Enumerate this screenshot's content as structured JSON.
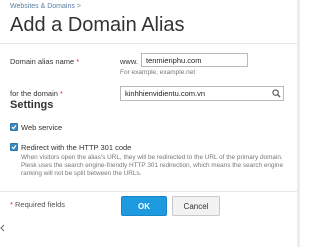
{
  "breadcrumb": {
    "link": "Websites & Domains",
    "separator": ">"
  },
  "page_title": "Add a Domain Alias",
  "form": {
    "alias_name": {
      "label": "Domain alias name",
      "required_mark": "*",
      "prefix": "www.",
      "value": "tenmienphu.com",
      "help": "For example, example.net"
    },
    "for_domain": {
      "label": "for the domain",
      "required_mark": "*",
      "value": "kinhhienvidientu.com.vn",
      "search_icon": "magnifier-icon"
    }
  },
  "settings": {
    "title": "Settings",
    "web_service": {
      "label": "Web service",
      "checked": true
    },
    "redirect_301": {
      "label": "Redirect with the HTTP 301 code",
      "checked": true,
      "description": "When visitors open the alias's URL, they will be redirected to the URL of the primary domain. Plesk uses the search engine-friendly HTTP 301 redirection, which means the search engine ranking will not be split between the URLs."
    }
  },
  "footer": {
    "required_mark": "*",
    "required_note": "Required fields",
    "ok_label": "OK",
    "cancel_label": "Cancel"
  },
  "colors": {
    "primary_button": "#1e9ae0",
    "checkbox": "#3a88c4",
    "required": "#d0312d",
    "link": "#5a7fa6"
  },
  "icons": {
    "collapse_handle": "chevron-left-icon"
  }
}
